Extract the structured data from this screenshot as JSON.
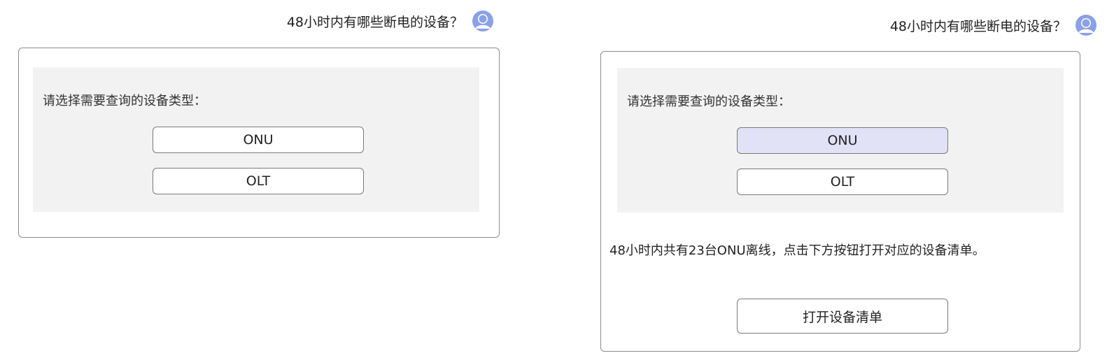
{
  "colors": {
    "avatar": "#8aa0e8",
    "card_border": "#8c8c8c",
    "select_bg": "#f2f2f2",
    "selected_button_bg": "#e2e2f6"
  },
  "left": {
    "user_question": "48小时内有哪些断电的设备？",
    "avatar_icon": "user-avatar-icon",
    "prompt": "请选择需要查询的设备类型：",
    "options": [
      {
        "label": "ONU",
        "selected": false
      },
      {
        "label": "OLT",
        "selected": false
      }
    ]
  },
  "right": {
    "user_question": "48小时内有哪些断电的设备？",
    "avatar_icon": "user-avatar-icon",
    "prompt": "请选择需要查询的设备类型：",
    "options": [
      {
        "label": "ONU",
        "selected": true
      },
      {
        "label": "OLT",
        "selected": false
      }
    ],
    "result_text": "48小时内共有23台ONU离线，点击下方按钮打开对应的设备清单。",
    "open_list_button": "打开设备清单"
  }
}
